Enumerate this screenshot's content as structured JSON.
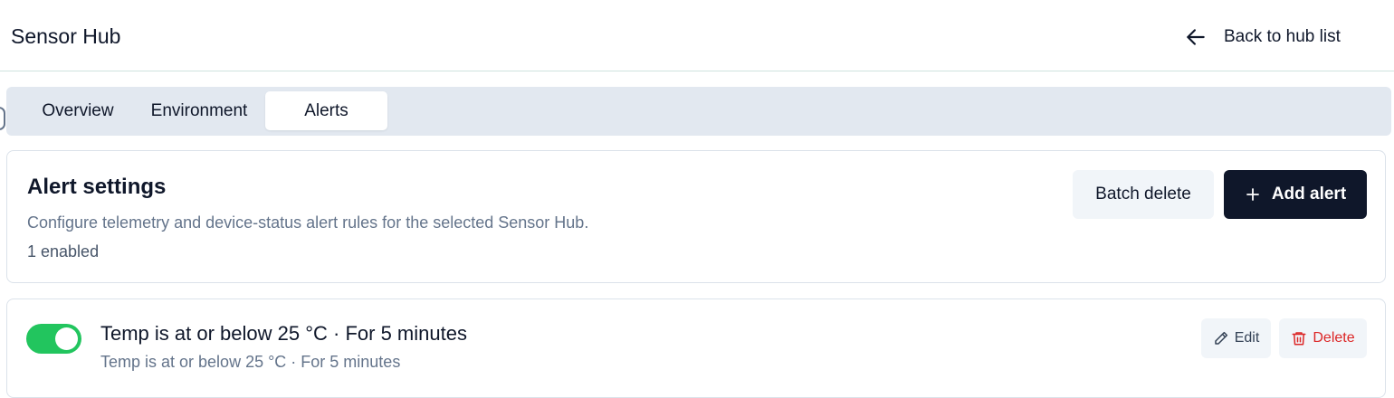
{
  "header": {
    "title": "Sensor Hub",
    "back_label": "Back to hub list",
    "back_icon": "arrow-left-icon"
  },
  "tabs": [
    {
      "label": "Overview",
      "active": false
    },
    {
      "label": "Environment",
      "active": false
    },
    {
      "label": "Alerts",
      "active": true
    }
  ],
  "alert_settings": {
    "title": "Alert settings",
    "description": "Configure telemetry and device-status alert rules for the selected Sensor Hub.",
    "enabled_count": "1 enabled",
    "batch_delete_label": "Batch delete",
    "add_alert_label": "Add alert",
    "add_icon": "plus-icon"
  },
  "rules": [
    {
      "enabled": true,
      "title": "Temp is at or below 25 °C · For 5 minutes",
      "subtitle": "Temp is at or below 25 °C · For 5 minutes",
      "edit_label": "Edit",
      "delete_label": "Delete",
      "edit_icon": "pencil-icon",
      "delete_icon": "trash-icon"
    }
  ],
  "colors": {
    "accent_dark": "#0f172a",
    "toggle_on": "#22c55e",
    "danger": "#dc2626",
    "muted_text": "#64748b",
    "tabbar_bg": "#e2e8f0"
  }
}
